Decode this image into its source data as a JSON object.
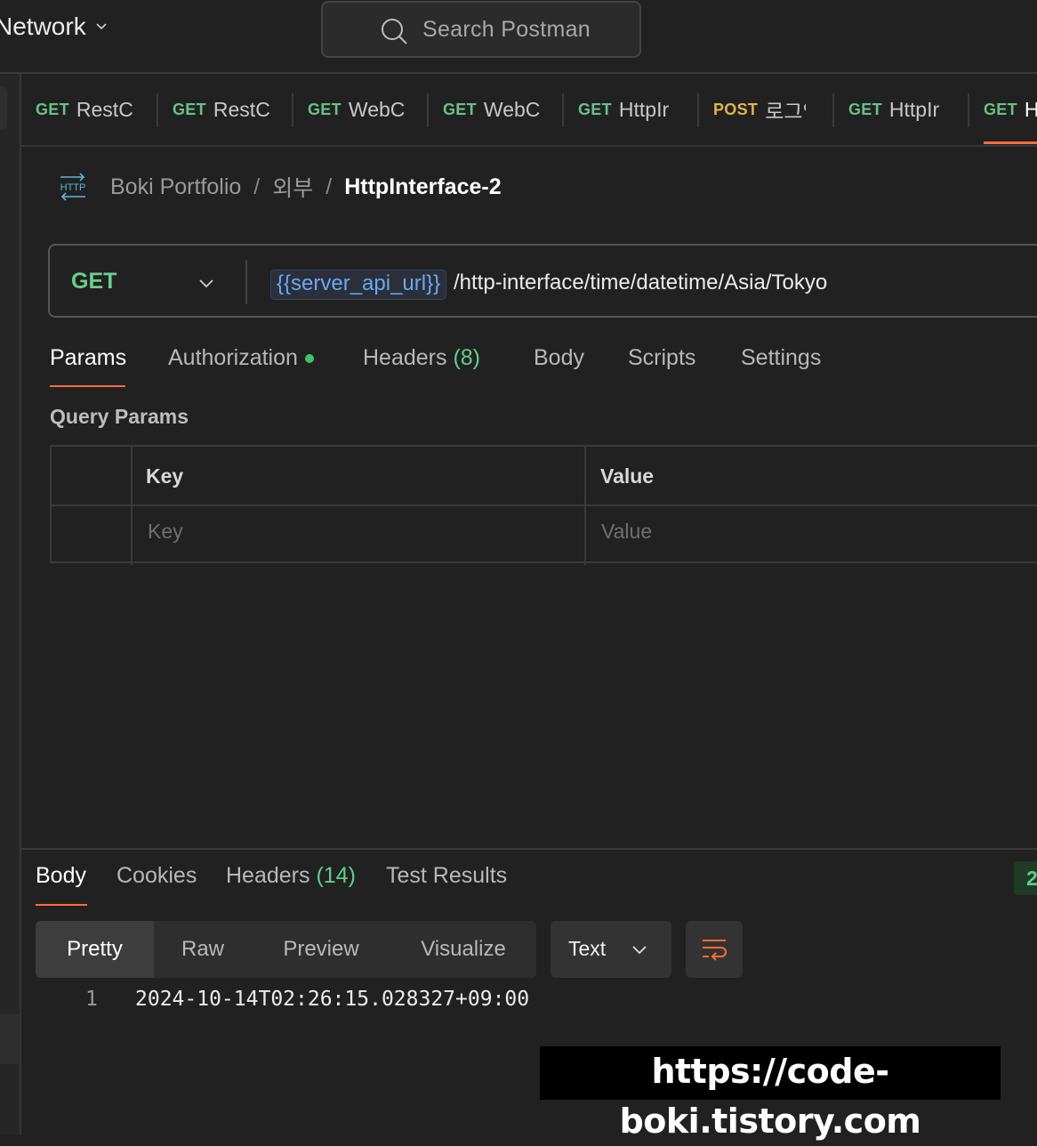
{
  "topbar": {
    "workspace_label": "Network",
    "search_placeholder": "Search Postman"
  },
  "open_tabs": [
    {
      "method": "GET",
      "name": "RestC"
    },
    {
      "method": "GET",
      "name": "RestC"
    },
    {
      "method": "GET",
      "name": "WebC"
    },
    {
      "method": "GET",
      "name": "WebC"
    },
    {
      "method": "GET",
      "name": "HttpIr"
    },
    {
      "method": "POST",
      "name": "로그인"
    },
    {
      "method": "GET",
      "name": "HttpIr"
    },
    {
      "method": "GET",
      "name": "H"
    }
  ],
  "breadcrumb": {
    "icon_text": "HTTP",
    "collection": "Boki Portfolio",
    "separator": "/",
    "folder": "외부",
    "current": "HttpInterface-2"
  },
  "request": {
    "method": "GET",
    "url_variable": "{{server_api_url}}",
    "url_path": "/http-interface/time/datetime/Asia/Tokyo"
  },
  "request_tabs": {
    "params": "Params",
    "authorization": "Authorization",
    "headers": "Headers",
    "headers_count": "(8)",
    "body": "Body",
    "scripts": "Scripts",
    "settings": "Settings"
  },
  "query_params": {
    "title": "Query Params",
    "col_key": "Key",
    "col_value": "Value",
    "key_placeholder": "Key",
    "value_placeholder": "Value"
  },
  "response_tabs": {
    "body": "Body",
    "cookies": "Cookies",
    "headers": "Headers",
    "headers_count": "(14)",
    "test_results": "Test Results",
    "status_fragment": "2"
  },
  "response_format": {
    "pretty": "Pretty",
    "raw": "Raw",
    "preview": "Preview",
    "visualize": "Visualize",
    "type": "Text"
  },
  "response_body": {
    "line_number": "1",
    "line": "2024-10-14T02:26:15.028327+09:00"
  },
  "watermark": "https://code-boki.tistory.com",
  "colors": {
    "accent": "#ff6c37",
    "get": "#6bbf8a",
    "post": "#e0b54b",
    "variable": "#6ea6f2"
  }
}
